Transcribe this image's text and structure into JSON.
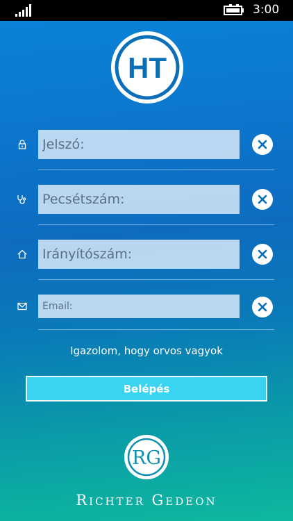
{
  "status_bar": {
    "time": "3:00",
    "signal_icon": "signal-bars-icon",
    "battery_icon": "battery-charging-icon"
  },
  "app": {
    "logo_text": "HT"
  },
  "form": {
    "fields": [
      {
        "icon": "lock-icon",
        "placeholder": "Jelszó:",
        "clear_icon": "close-icon"
      },
      {
        "icon": "stethoscope-icon",
        "placeholder": "Pecsétszám:",
        "clear_icon": "close-icon"
      },
      {
        "icon": "home-icon",
        "placeholder": "Irányítószám:",
        "clear_icon": "close-icon"
      },
      {
        "icon": "mail-icon",
        "placeholder": "Email:",
        "clear_icon": "close-icon"
      }
    ],
    "verify_text": "Igazolom, hogy orvos vagyok",
    "login_label": "Belépés"
  },
  "footer": {
    "brand_monogram": "RG",
    "brand_name": "Richter Gedeon"
  },
  "colors": {
    "field_bg": "#d6e8f8",
    "button_bg": "#3ad3f2",
    "clear_btn_icon": "#0b6fb8"
  }
}
